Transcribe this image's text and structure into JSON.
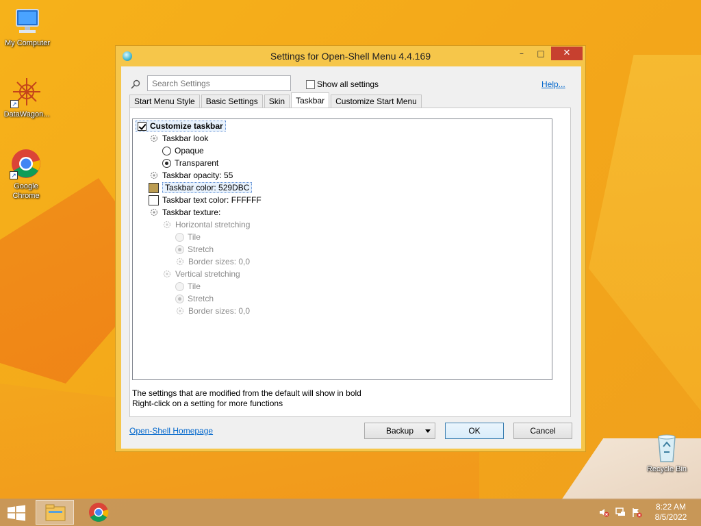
{
  "desktop": {
    "icons": [
      {
        "label": "My Computer",
        "icon": "computer-icon"
      },
      {
        "label": "DataWagon...",
        "icon": "datawagon-icon"
      },
      {
        "label": "Google Chrome",
        "icon": "chrome-icon"
      },
      {
        "label": "Recycle Bin",
        "icon": "recycle-bin-icon"
      }
    ]
  },
  "window": {
    "title": "Settings for Open-Shell Menu 4.4.169",
    "minimize_glyph": "▭",
    "maximize_glyph": "□",
    "close_glyph": "✕"
  },
  "search": {
    "placeholder": "Search Settings",
    "value": ""
  },
  "show_all": {
    "label": "Show all settings",
    "checked": false
  },
  "help_link": "Help...",
  "tabs": [
    {
      "label": "Start Menu Style",
      "active": false
    },
    {
      "label": "Basic Settings",
      "active": false
    },
    {
      "label": "Skin",
      "active": false
    },
    {
      "label": "Taskbar",
      "active": true
    },
    {
      "label": "Customize Start Menu",
      "active": false
    }
  ],
  "tree": {
    "customize_taskbar": "Customize taskbar",
    "taskbar_look": "Taskbar look",
    "opaque": "Opaque",
    "transparent": "Transparent",
    "taskbar_opacity": "Taskbar opacity: 55",
    "taskbar_color": "Taskbar color: 529DBC",
    "taskbar_text_color": "Taskbar text color: FFFFFF",
    "taskbar_texture": "Taskbar texture:",
    "horizontal_stretching": "Horizontal stretching",
    "h_tile": "Tile",
    "h_stretch": "Stretch",
    "h_border_sizes": "Border sizes: 0,0",
    "vertical_stretching": "Vertical stretching",
    "v_tile": "Tile",
    "v_stretch": "Stretch",
    "v_border_sizes": "Border sizes: 0,0"
  },
  "colors": {
    "taskbar_color_swatch": "#BC9D52",
    "taskbar_text_color_swatch": "#FFFFFF",
    "close_button": "#C7402F"
  },
  "info": {
    "line1": "The settings that are modified from the default will show in bold",
    "line2": "Right-click on a setting for more functions"
  },
  "footer": {
    "homepage_link": "Open-Shell Homepage",
    "backup_label": "Backup",
    "ok_label": "OK",
    "cancel_label": "Cancel"
  },
  "taskbar": {
    "time": "8:22 AM",
    "date": "8/5/2022"
  }
}
